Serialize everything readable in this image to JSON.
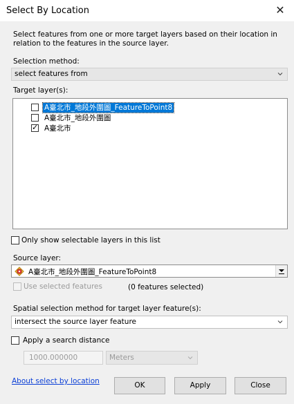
{
  "window": {
    "title": "Select By Location"
  },
  "intro": "Select features from one or more target layers based on their location in relation to the features in the source layer.",
  "selection_method": {
    "label": "Selection method:",
    "value": "select features from"
  },
  "target_layers": {
    "label": "Target layer(s):",
    "items": [
      {
        "label": "A臺北市_地段外圍圖_FeatureToPoint8",
        "checked": false,
        "selected": true
      },
      {
        "label": "A臺北市_地段外圍圖",
        "checked": false,
        "selected": false
      },
      {
        "label": "A臺北市",
        "checked": true,
        "selected": false
      }
    ]
  },
  "only_selectable": {
    "label": "Only show selectable layers in this list",
    "checked": false
  },
  "source_layer": {
    "label": "Source layer:",
    "value": "A臺北市_地段外圍圖_FeatureToPoint8",
    "icon": "point-layer-icon"
  },
  "use_selected": {
    "label": "Use selected features",
    "checked": false,
    "enabled": false
  },
  "features_selected": "(0 features selected)",
  "spatial_method": {
    "label": "Spatial selection method for target layer feature(s):",
    "value": "intersect the source layer feature"
  },
  "search_distance": {
    "label": "Apply a search distance",
    "checked": false,
    "value": "1000.000000",
    "unit": "Meters"
  },
  "link": "About select by location",
  "buttons": {
    "ok": "OK",
    "apply": "Apply",
    "close": "Close"
  },
  "colors": {
    "selection": "#0078d7",
    "link": "#0b3fd6",
    "dialog_bg": "#f0f0f0"
  }
}
